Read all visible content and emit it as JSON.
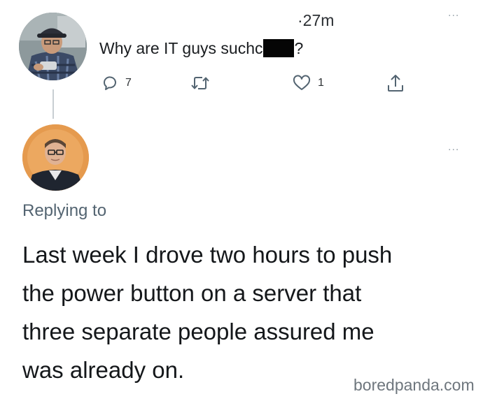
{
  "tweet": {
    "time": "·27m",
    "text_before": "Why are IT guys such ",
    "text_partial_letter": "c",
    "text_after": "?",
    "reply_count": "7",
    "retweet_count": "",
    "like_count": "1",
    "icons": [
      "comment-icon",
      "retweet-icon",
      "heart-icon",
      "share-icon",
      "more-icon"
    ]
  },
  "reply": {
    "replying_to": "Replying to",
    "lines": [
      "Last week I drove two hours to push",
      "the power button on a server that",
      "three separate people assured me",
      "was already on."
    ]
  },
  "dots": "...",
  "watermark": "boredpanda.com"
}
